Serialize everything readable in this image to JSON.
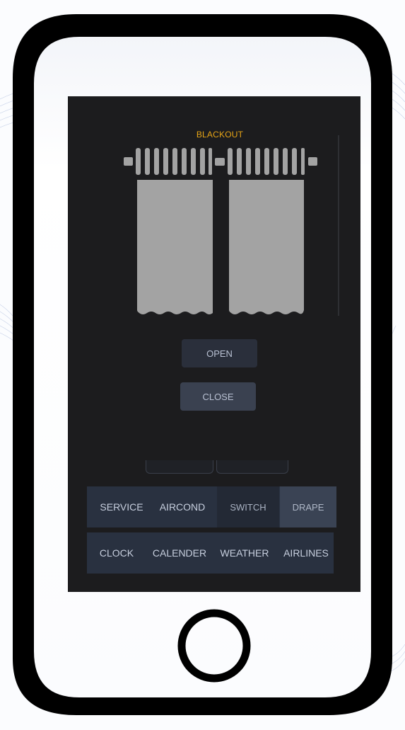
{
  "drape": {
    "title": "BLACKOUT",
    "curtain_fill_color": "#a3a3a3",
    "accent_color": "#e7a516"
  },
  "controls": {
    "open_label": "OPEN",
    "close_label": "CLOSE"
  },
  "nav": {
    "row1": [
      "SERVICE",
      "AIRCOND",
      "SWITCH",
      "DRAPE"
    ],
    "row2": [
      "CLOCK",
      "CALENDER",
      "WEATHER",
      "AIRLINES"
    ],
    "active": "DRAPE"
  }
}
